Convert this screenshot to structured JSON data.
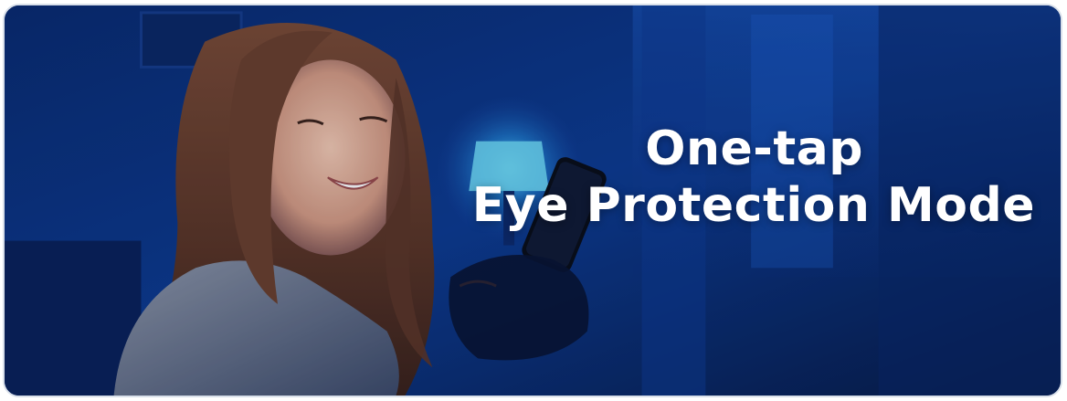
{
  "banner": {
    "headline_line1": "One-tap",
    "headline_line2": "Eye Protection Mode"
  },
  "photo": {
    "subject": "smiling woman using a smartphone in a dark bedroom",
    "background_color": "#0b1f52",
    "lamp_glow_color": "#5fe0ff",
    "text_color": "#ffffff"
  }
}
